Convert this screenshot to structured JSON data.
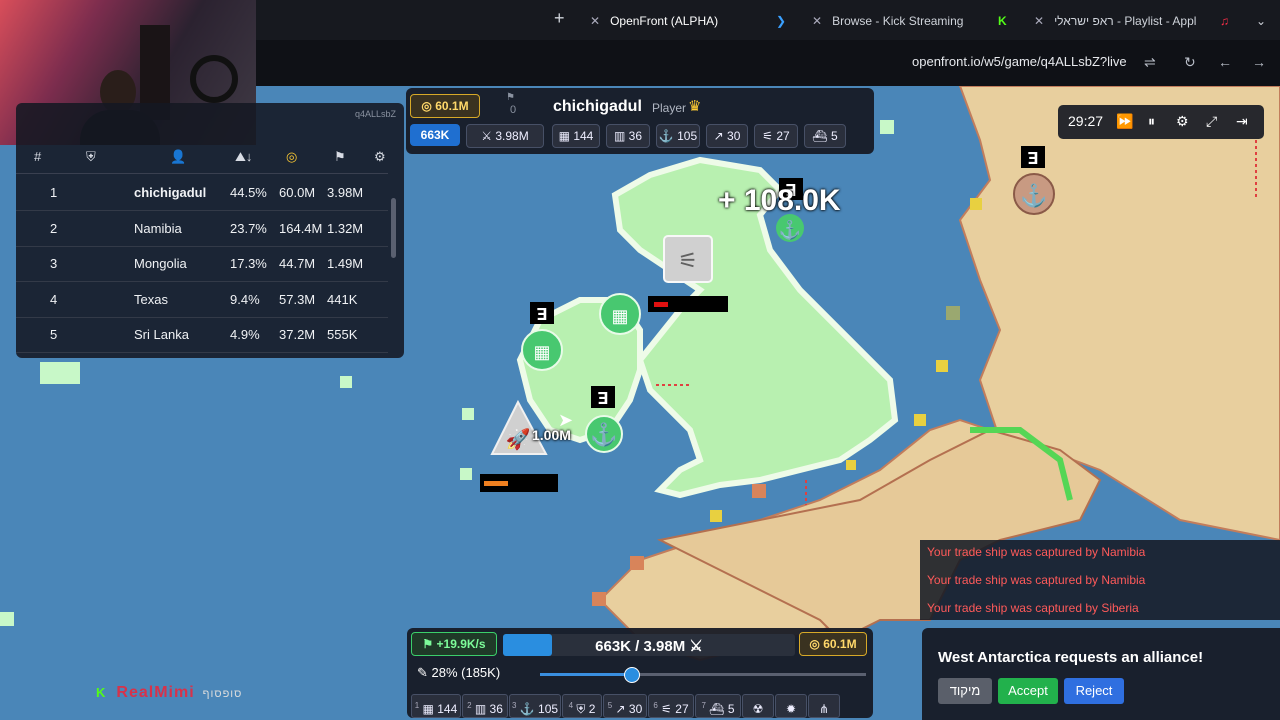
{
  "browser": {
    "tabs": [
      {
        "label": "OpenFront (ALPHA)",
        "active": true
      },
      {
        "label": "Browse - Kick Streaming",
        "active": false
      },
      {
        "label": "ראפ ישראלי - Playlist - Appl",
        "active": false
      }
    ],
    "url": "openfront.io/w5/game/q4ALLsbZ?live",
    "new_tab_icon": "plus-icon"
  },
  "leaderboard": {
    "game_id": "q4ALLsbZ",
    "headers": {
      "rank": "#"
    },
    "rows": [
      {
        "rank": "1",
        "name": "chichigadul",
        "percent": "44.5%",
        "gold": "60.0M",
        "troops": "3.98M",
        "bold": true
      },
      {
        "rank": "2",
        "name": "Namibia",
        "percent": "23.7%",
        "gold": "164.4M",
        "troops": "1.32M"
      },
      {
        "rank": "3",
        "name": "Mongolia",
        "percent": "17.3%",
        "gold": "44.7M",
        "troops": "1.49M"
      },
      {
        "rank": "4",
        "name": "Texas",
        "percent": "9.4%",
        "gold": "57.3M",
        "troops": "441K"
      },
      {
        "rank": "5",
        "name": "Sri Lanka",
        "percent": "4.9%",
        "gold": "37.2M",
        "troops": "555K"
      }
    ]
  },
  "player_stats": {
    "gold": "60.1M",
    "attacking_troops": "0",
    "name": "chichigadul",
    "role": "Player",
    "population": "663K",
    "troops": "3.98M",
    "cities": "144",
    "factories": "36",
    "ports": "105",
    "missiles": "30",
    "sams": "27",
    "ships": "5"
  },
  "game_controls": {
    "timer": "29:27"
  },
  "map_labels": {
    "gold_popup": "+ 108.0K",
    "attack_amount": "1.00M"
  },
  "bottom_panel": {
    "income": "+19.9K/s",
    "population": "663K / 3.98M",
    "population_fraction": 0.167,
    "gold": "60.1M",
    "attack_ratio": "28% (185K)",
    "attack_ratio_fraction": 0.28,
    "build_bar": [
      {
        "key": "1",
        "icon": "city-icon",
        "count": "144"
      },
      {
        "key": "2",
        "icon": "factory-icon",
        "count": "36"
      },
      {
        "key": "3",
        "icon": "port-icon",
        "count": "105"
      },
      {
        "key": "4",
        "icon": "defense-post-icon",
        "count": "2"
      },
      {
        "key": "5",
        "icon": "missile-silo-icon",
        "count": "30"
      },
      {
        "key": "6",
        "icon": "sam-launcher-icon",
        "count": "27"
      },
      {
        "key": "7",
        "icon": "warship-icon",
        "count": "5"
      },
      {
        "key": "",
        "icon": "nuke-icon",
        "count": ""
      },
      {
        "key": "",
        "icon": "hydrogen-bomb-icon",
        "count": ""
      },
      {
        "key": "",
        "icon": "mirv-icon",
        "count": ""
      }
    ]
  },
  "notifications": [
    "Your trade ship was captured by Namibia",
    "Your trade ship was captured by Namibia",
    "Your trade ship was captured by Siberia"
  ],
  "alliance_request": {
    "message": "West Antarctica requests an alliance!",
    "focus_label": "מיקוד",
    "accept_label": "Accept",
    "reject_label": "Reject"
  },
  "streamer_watermark": {
    "name": "RealMimi",
    "hebrew": "סופסוף"
  },
  "colors": {
    "ocean": "#4a86b8",
    "player_territory": "#b8f0b0",
    "player_border": "#eefbe8",
    "enemy_land": "#e8cf9e",
    "accent_gold": "#d7a928",
    "accent_blue": "#2a8ee0",
    "accept_green": "#22b14c",
    "reject_blue": "#2f6fe0",
    "alert_red": "#ff5a5a"
  }
}
